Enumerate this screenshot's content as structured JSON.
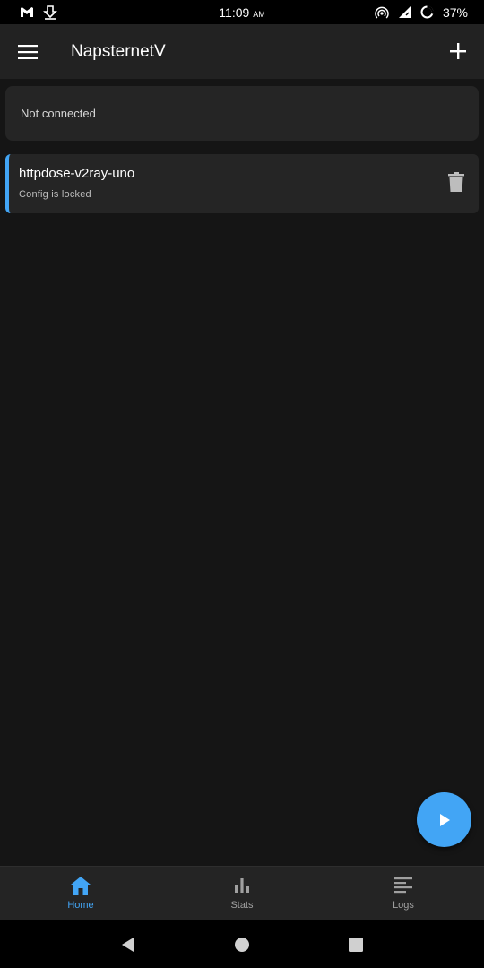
{
  "status_bar": {
    "time": "11:09",
    "time_suffix": "AM",
    "battery": "37%",
    "left_icons": [
      "gmail-icon",
      "download-icon"
    ],
    "right_icons": [
      "hotspot-icon",
      "signal-icon",
      "battery-icon"
    ]
  },
  "app_bar": {
    "title": "NapsternetV",
    "menu_icon": "menu-icon",
    "add_icon": "plus-icon"
  },
  "connection_status": {
    "text": "Not connected"
  },
  "configs": [
    {
      "name": "httpdose-v2ray-uno",
      "subtitle": "Config is locked",
      "action_icon": "trash-icon"
    }
  ],
  "fab": {
    "icon": "play-icon"
  },
  "bottom_nav": {
    "items": [
      {
        "label": "Home",
        "icon": "home-icon",
        "active": true
      },
      {
        "label": "Stats",
        "icon": "bar-chart-icon",
        "active": false
      },
      {
        "label": "Logs",
        "icon": "logs-icon",
        "active": false
      }
    ]
  },
  "system_nav": {
    "icons": [
      "back-icon",
      "home-circle-icon",
      "recents-icon"
    ]
  },
  "colors": {
    "accent": "#42a5f5",
    "background": "#151515",
    "surface": "#252525",
    "app_bar": "#222222"
  }
}
